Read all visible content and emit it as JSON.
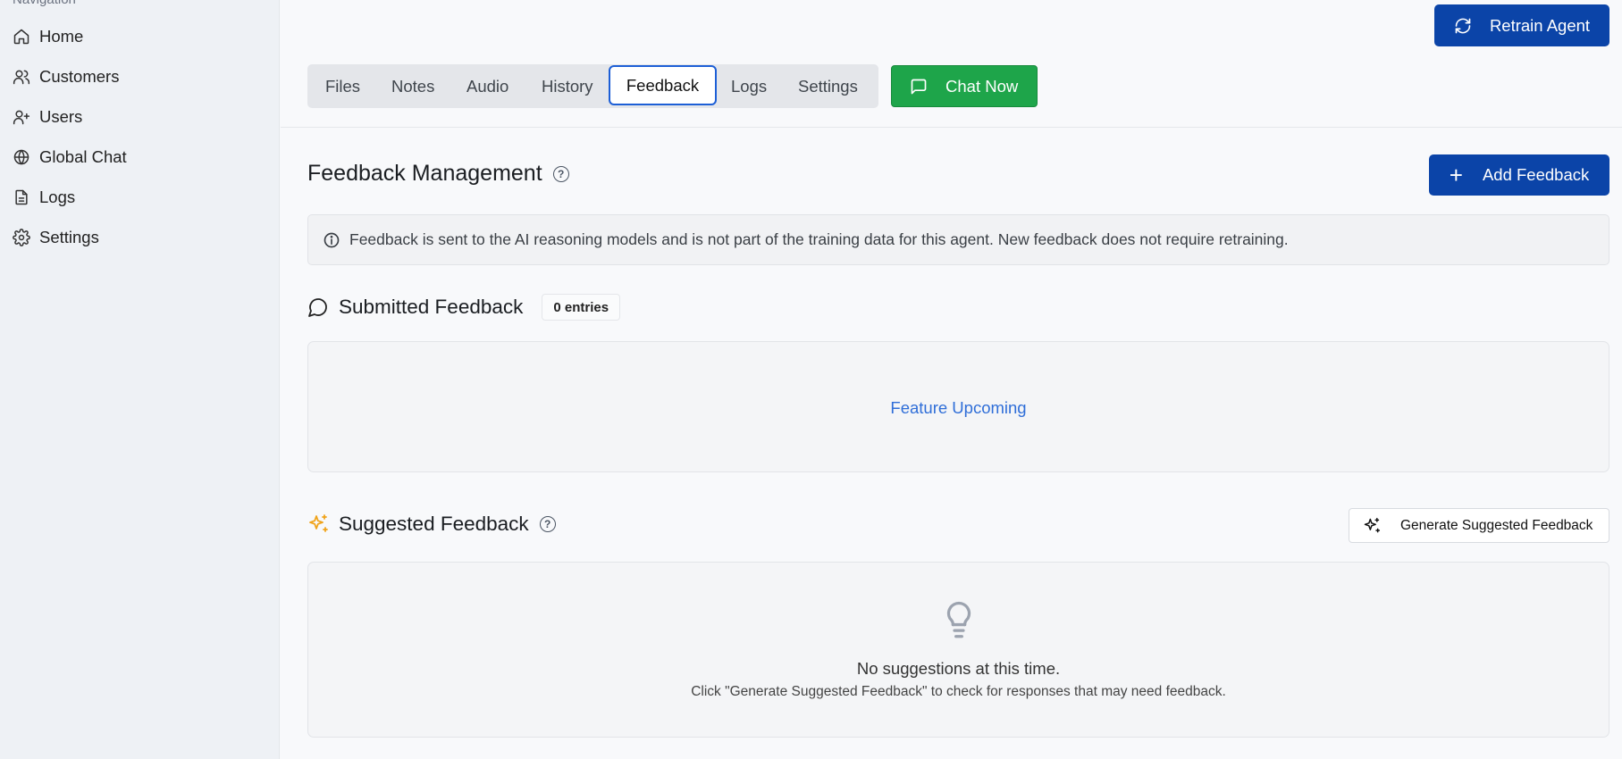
{
  "sidebar": {
    "heading": "Navigation",
    "items": [
      {
        "label": "Home",
        "icon": "home-icon"
      },
      {
        "label": "Customers",
        "icon": "users-icon"
      },
      {
        "label": "Users",
        "icon": "user-plus-icon"
      },
      {
        "label": "Global Chat",
        "icon": "globe-icon"
      },
      {
        "label": "Logs",
        "icon": "file-text-icon"
      },
      {
        "label": "Settings",
        "icon": "gear-icon"
      }
    ]
  },
  "header": {
    "retrain_label": "Retrain Agent",
    "tabs": [
      {
        "label": "Files"
      },
      {
        "label": "Notes"
      },
      {
        "label": "Audio"
      },
      {
        "label": "History"
      },
      {
        "label": "Feedback",
        "active": true
      },
      {
        "label": "Logs"
      },
      {
        "label": "Settings"
      }
    ],
    "chat_label": "Chat Now"
  },
  "main": {
    "title": "Feedback Management",
    "add_label": "Add Feedback",
    "info_text": "Feedback is sent to the AI reasoning models and is not part of the training data for this agent. New feedback does not require retraining.",
    "submitted": {
      "title": "Submitted Feedback",
      "badge": "0 entries",
      "placeholder": "Feature Upcoming"
    },
    "suggested": {
      "title": "Suggested Feedback",
      "generate_label": "Generate Suggested Feedback",
      "empty_title": "No suggestions at this time.",
      "empty_sub": "Click \"Generate Suggested Feedback\" to check for responses that may need feedback."
    }
  },
  "colors": {
    "primary": "#0b44a8",
    "success": "#1ea54a",
    "link": "#2f6ed8",
    "accent_sparkle": "#f0a31a",
    "active_tab_border": "#1d5fd6"
  }
}
